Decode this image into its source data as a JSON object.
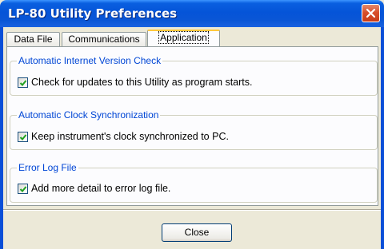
{
  "window": {
    "title": "LP-80 Utility Preferences"
  },
  "tabs": [
    {
      "label": "Data File"
    },
    {
      "label": "Communications"
    },
    {
      "label": "Application",
      "active": true
    }
  ],
  "groups": [
    {
      "title": "Automatic Internet Version Check",
      "option": {
        "label": "Check for updates to this Utility as program starts.",
        "checked": true
      }
    },
    {
      "title": "Automatic Clock Synchronization",
      "option": {
        "label": "Keep instrument's clock synchronized to PC.",
        "checked": true
      }
    },
    {
      "title": "Error Log File",
      "option": {
        "label": "Add more detail to error log file.",
        "checked": true
      }
    }
  ],
  "footer": {
    "close_label": "Close"
  },
  "colors": {
    "titlebar": "#0554d8",
    "group_title": "#0046d5",
    "close_x": "#d8502c"
  },
  "icons": {
    "close": "close-x-icon",
    "check": "checkmark-icon"
  }
}
